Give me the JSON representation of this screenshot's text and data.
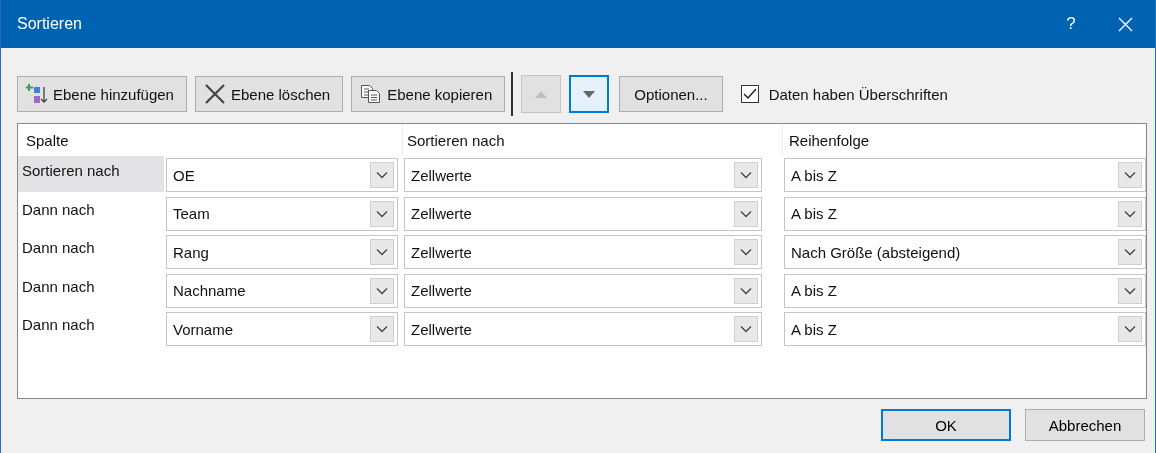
{
  "window": {
    "title": "Sortieren",
    "help": "?"
  },
  "toolbar": {
    "buttons": [
      {
        "kind": "add",
        "label": "Ebene hinzufügen"
      },
      {
        "kind": "delete",
        "label": "Ebene löschen"
      },
      {
        "kind": "copy",
        "label": "Ebene kopieren"
      }
    ],
    "move_up": {
      "disabled": true,
      "focused": false
    },
    "move_down": {
      "disabled": false,
      "focused": true
    },
    "options": {
      "label": "Optionen..."
    },
    "headers_checkbox": {
      "label": "Daten haben Überschriften",
      "checked": true
    }
  },
  "table": {
    "columns": [
      "Spalte",
      "Sortieren nach",
      "Reihenfolge"
    ],
    "rows": [
      {
        "label": "Sortieren nach",
        "selected": true,
        "column": "OE",
        "sort_on": "Zellwerte",
        "order": "A bis Z"
      },
      {
        "label": "Dann nach",
        "selected": false,
        "column": "Team",
        "sort_on": "Zellwerte",
        "order": "A bis Z"
      },
      {
        "label": "Dann nach",
        "selected": false,
        "column": "Rang",
        "sort_on": "Zellwerte",
        "order": "Nach Größe (absteigend)"
      },
      {
        "label": "Dann nach",
        "selected": false,
        "column": "Nachname",
        "sort_on": "Zellwerte",
        "order": "A bis Z"
      },
      {
        "label": "Dann nach",
        "selected": false,
        "column": "Vorname",
        "sort_on": "Zellwerte",
        "order": "A bis Z"
      }
    ]
  },
  "buttons": [
    {
      "label": "OK",
      "default": true
    },
    {
      "label": "Abbrechen",
      "default": false
    }
  ]
}
